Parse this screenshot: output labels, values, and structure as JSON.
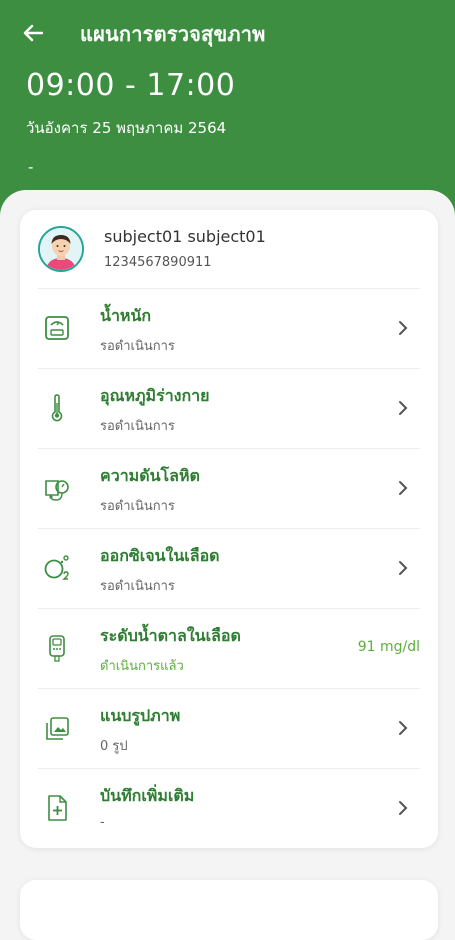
{
  "header": {
    "title": "แผนการตรวจสุขภาพ",
    "time": "09:00 - 17:00",
    "date": "วันอังคาร 25 พฤษภาคม 2564",
    "note": "-"
  },
  "profile": {
    "name": "subject01 subject01",
    "id": "1234567890911"
  },
  "items": [
    {
      "label": "น้ำหนัก",
      "status": "รอดำเนินการ",
      "value": "",
      "icon": "scale-icon"
    },
    {
      "label": "อุณหภูมิร่างกาย",
      "status": "รอดำเนินการ",
      "value": "",
      "icon": "thermometer-icon"
    },
    {
      "label": "ความดันโลหิต",
      "status": "รอดำเนินการ",
      "value": "",
      "icon": "blood-pressure-icon"
    },
    {
      "label": "ออกซิเจนในเลือด",
      "status": "รอดำเนินการ",
      "value": "",
      "icon": "oxygen-icon"
    },
    {
      "label": "ระดับน้ำตาลในเลือด",
      "status": "ดำเนินการแล้ว",
      "value": "91 mg/dl",
      "icon": "glucose-meter-icon"
    },
    {
      "label": "แนบรูปภาพ",
      "status": "0 รูป",
      "value": "",
      "icon": "image-icon"
    },
    {
      "label": "บันทึกเพิ่มเติม",
      "status": "-",
      "value": "",
      "icon": "note-add-icon"
    }
  ],
  "colors": {
    "brand": "#3e8e42",
    "label_green": "#2e7d32",
    "done_green": "#5cae3e"
  }
}
